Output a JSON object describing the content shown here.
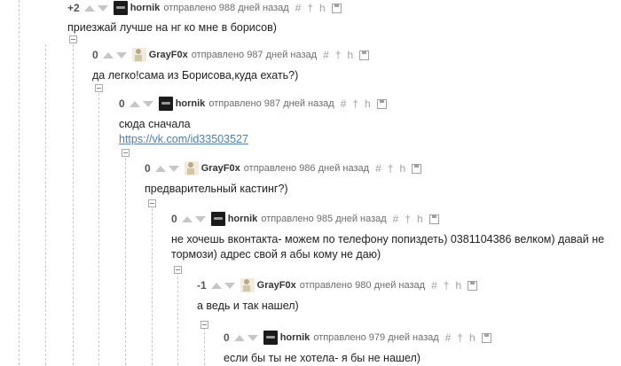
{
  "comments": [
    {
      "rating": "+2",
      "user": "hornik",
      "sent": "отправлено 988 дней назад",
      "text": "приезжай лучше на нг ко мне в борисов)"
    },
    {
      "rating": "0",
      "user": "GrayF0x",
      "sent": "отправлено 987 дней назад",
      "text": "да легко!сама из Борисова,куда ехать?)"
    },
    {
      "rating": "0",
      "user": "hornik",
      "sent": "отправлено 987 дней назад",
      "text": "сюда сначала",
      "link": "https://vk.com/id33503527"
    },
    {
      "rating": "0",
      "user": "GrayF0x",
      "sent": "отправлено 986 дней назад",
      "text": "предварительный кастинг?)"
    },
    {
      "rating": "0",
      "user": "hornik",
      "sent": "отправлено 985 дней назад",
      "text": "не хочешь вконтакта- можем по телефону попиздеть) 0381104386 велком) давай не",
      "text2": "тормози) адрес свой я абы кому не даю)"
    },
    {
      "rating": "-1",
      "user": "GrayF0x",
      "sent": "отправлено 980 дней назад",
      "text": "а ведь и так нашел)"
    },
    {
      "rating": "0",
      "user": "hornik",
      "sent": "отправлено 979 дней назад",
      "text": "если бы ты не хотела- я бы не нашел)"
    }
  ],
  "tools": {
    "hash": "#",
    "pin": "†",
    "branch": "h"
  },
  "icons": [
    "up-vote-arrow",
    "down-vote-arrow",
    "avatar",
    "hash-icon",
    "pin-icon",
    "branch-icon",
    "save-icon"
  ]
}
